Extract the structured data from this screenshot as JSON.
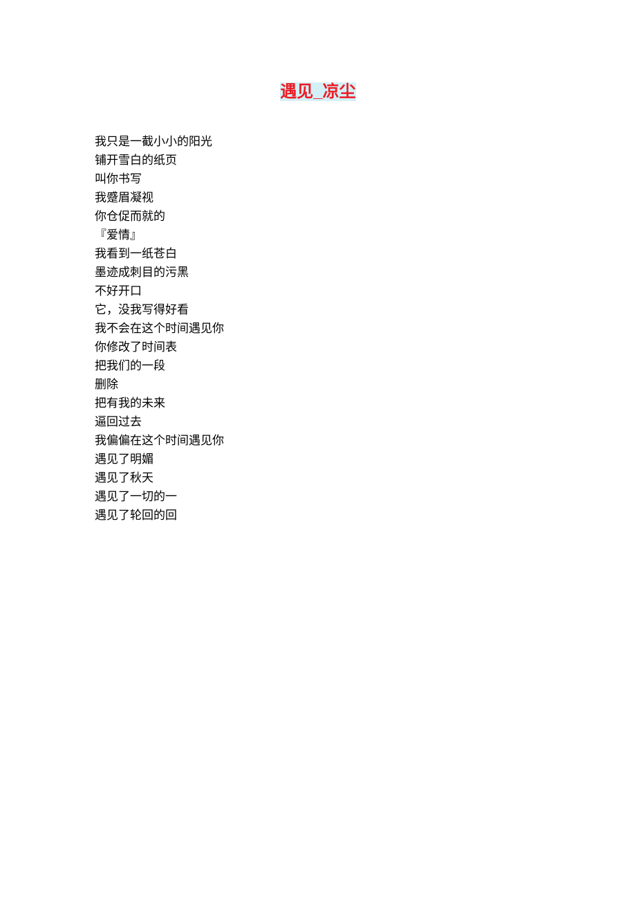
{
  "title": {
    "part1": "遇见",
    "separator": "_",
    "part2": "凉尘"
  },
  "poem": {
    "lines": [
      "我只是一截小小的阳光",
      "铺开雪白的纸页",
      "叫你书写",
      "我蹙眉凝视",
      "你仓促而就的",
      "『爱情』",
      "我看到一纸苍白",
      "墨迹成刺目的污黑",
      "不好开口",
      "它，没我写得好看",
      "我不会在这个时间遇见你",
      "你修改了时间表",
      "把我们的一段",
      "删除",
      "把有我的未来",
      "逼回过去",
      "我偏偏在这个时间遇见你",
      "遇见了明媚",
      "遇见了秋天",
      "遇见了一切的一",
      "遇见了轮回的回"
    ]
  }
}
